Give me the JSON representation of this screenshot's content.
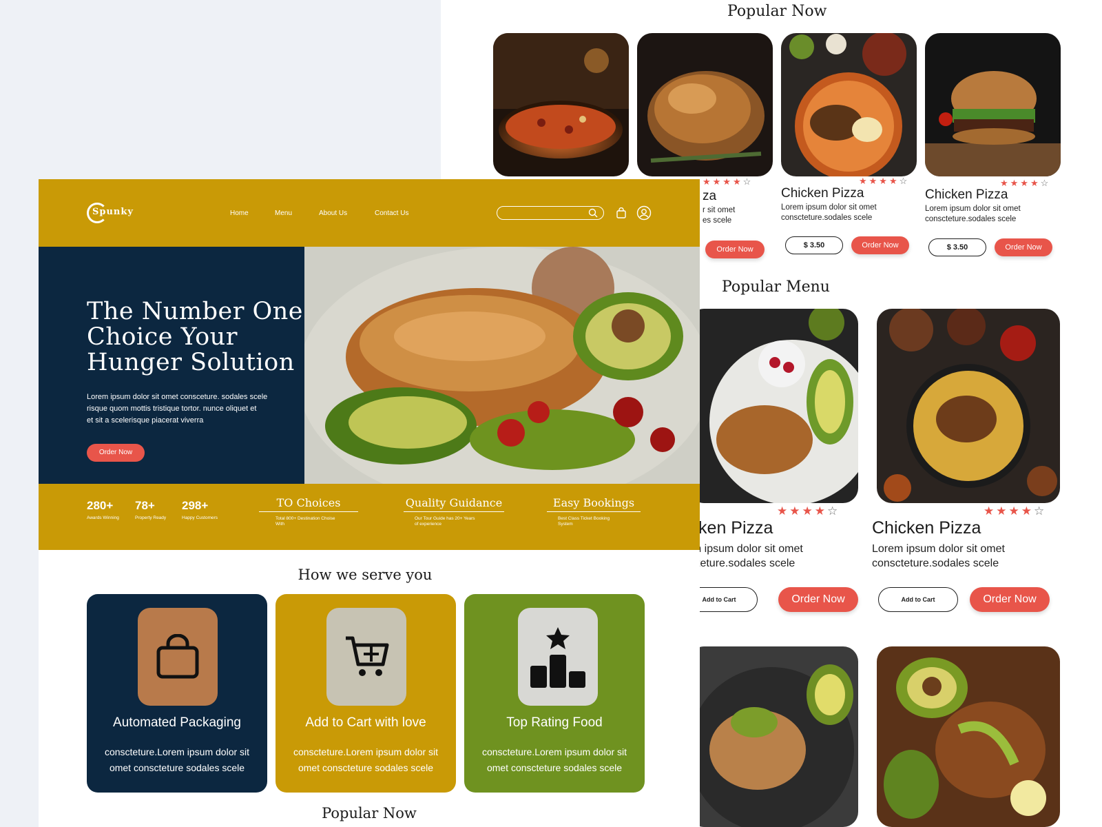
{
  "colors": {
    "brand_gold": "#c99a06",
    "navy": "#0c2740",
    "coral": "#e8554a",
    "olive": "#6f9220",
    "brown_icon": "#b87a4b"
  },
  "brand": {
    "logo_text": "Spunky"
  },
  "nav": {
    "links": [
      "Home",
      "Menu",
      "About Us",
      "Contact Us"
    ],
    "search_placeholder": "",
    "icons": [
      "search-icon",
      "bag-icon",
      "user-icon"
    ]
  },
  "hero": {
    "title_line1": "The Number One",
    "title_line2": "Choice Your",
    "title_line3": "Hunger Solution",
    "desc_line1": "Lorem ipsum dolor sit  omet consceture. sodales scele",
    "desc_line2": "risque quom mottis tristique tortor. nunce oliquet et",
    "desc_line3": "et sit  a scelerisque piacerat viverra",
    "cta": "Order Now"
  },
  "stats": [
    {
      "value": "280+",
      "label": "Awards Winning"
    },
    {
      "value": "78+",
      "label": "Property Ready"
    },
    {
      "value": "298+",
      "label": "Happy Customers"
    }
  ],
  "features": [
    {
      "title": "TO Choices",
      "desc_line1": "Total 800+ Destination Choise",
      "desc_line2": "With"
    },
    {
      "title": "Quality Guidance",
      "desc_line1": "Our Tour Guide has 20+ Years",
      "desc_line2": "of experience"
    },
    {
      "title": "Easy Bookings",
      "desc_line1": "Best Class Ticket Booking",
      "desc_line2": "System"
    }
  ],
  "serve": {
    "heading": "How we serve you",
    "cards": [
      {
        "title": "Automated Packaging",
        "desc_line1": "conscteture.Lorem ipsum dolor sit",
        "desc_line2": "omet consctet​ure  sodales scele",
        "icon": "shopping-bag-icon"
      },
      {
        "title": "Add to Cart with love",
        "desc_line1": "consctet​ure.Lorem ipsum dolor sit",
        "desc_line2": "omet consctet​ure  sodales scele",
        "icon": "cart-add-icon"
      },
      {
        "title": "Top Rating Food",
        "desc_line1": "consctet​ure.Lorem ipsum dolor sit",
        "desc_line2": "omet consctet​ure  sodales scele",
        "icon": "podium-star-icon"
      }
    ]
  },
  "popular_now_bottom": "Popular Now",
  "popular_now": {
    "heading": "Popular Now",
    "cards": [
      {
        "name": "za",
        "desc_line1": "r sit omet",
        "desc_line2": "es scele",
        "rating": 4,
        "order": "Order Now"
      },
      {
        "name": "Chicken Pizza",
        "desc_line1": "Lorem ipsum dolor sit omet",
        "desc_line2": "consctet​ure.sodales scele",
        "rating": 4,
        "price": "$ 3.50",
        "order": "Order Now"
      },
      {
        "name": "Chicken Pizza",
        "desc_line1": "Lorem ipsum dolor sit omet",
        "desc_line2": "consctet​ure.sodales scele",
        "rating": 4,
        "price": "$ 3.50",
        "order": "Order Now"
      }
    ]
  },
  "popular_menu": {
    "heading": "Popular Menu",
    "cards": [
      {
        "name": "icken Pizza",
        "desc_line1": "em ipsum dolor sit omet",
        "desc_line2": "sctet​ure.sodales scele",
        "rating": 4,
        "cart": "Add to Cart",
        "order": "Order Now"
      },
      {
        "name": "Chicken Pizza",
        "desc_line1": "Lorem ipsum dolor sit omet",
        "desc_line2": "consctet​ure.sodales scele",
        "rating": 4,
        "cart": "Add to Cart",
        "order": "Order Now"
      }
    ]
  }
}
